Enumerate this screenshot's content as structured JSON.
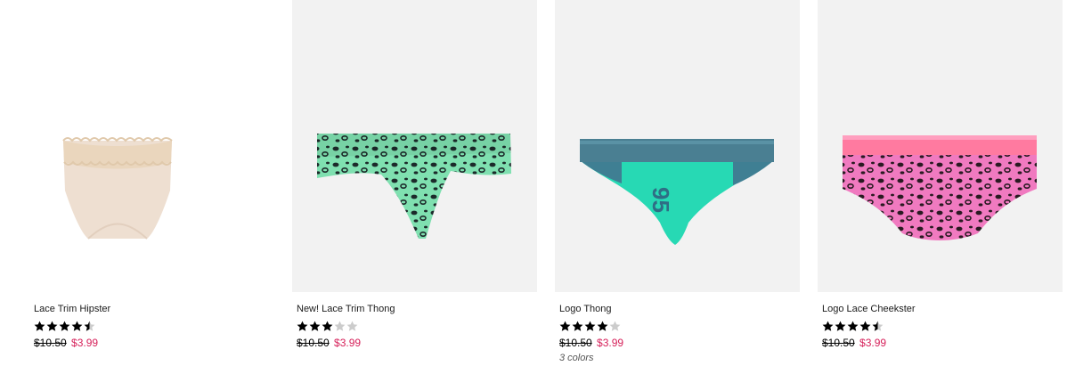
{
  "products": [
    {
      "name": "Lace Trim Hipster",
      "rating": 4.5,
      "old_price": "$10.50",
      "sale_price": "$3.99",
      "colors_label": ""
    },
    {
      "name": "New! Lace Trim Thong",
      "rating": 3,
      "old_price": "$10.50",
      "sale_price": "$3.99",
      "colors_label": ""
    },
    {
      "name": "Logo Thong",
      "rating": 4,
      "old_price": "$10.50",
      "sale_price": "$3.99",
      "colors_label": "3 colors"
    },
    {
      "name": "Logo Lace Cheekster",
      "rating": 4.5,
      "old_price": "$10.50",
      "sale_price": "$3.99",
      "colors_label": ""
    }
  ],
  "colors": {
    "sale_price": "#d6215a",
    "star_filled": "#000000",
    "star_empty": "#cccccc",
    "image_background": "#f2f2f2"
  },
  "icons": {
    "rating_star": "star-icon"
  }
}
